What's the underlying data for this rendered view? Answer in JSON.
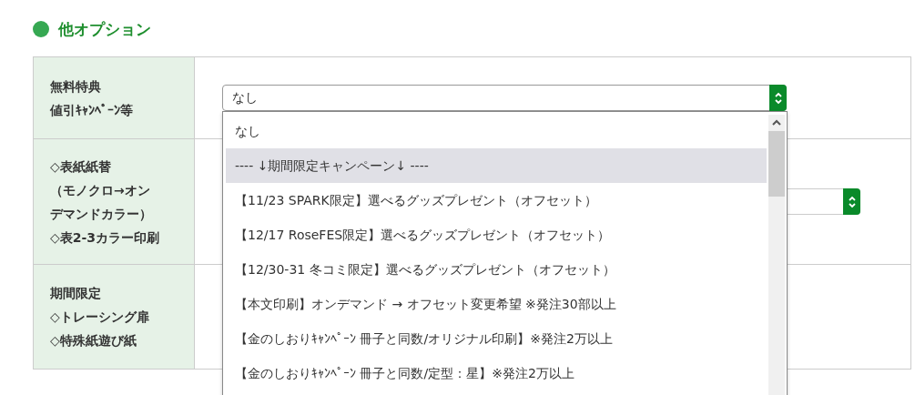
{
  "heading": "他オプション",
  "rows": [
    {
      "label_lines": [
        "無料特典",
        "値引ｷｬﾝﾍﾟｰﾝ等"
      ],
      "select": {
        "value": "なし",
        "open": true
      }
    },
    {
      "label_lines": [
        "◇表紙紙替",
        "（モノクロ→オン",
        "デマンドカラー）",
        "◇表2-3カラー印刷"
      ],
      "select": {
        "open": false
      }
    },
    {
      "label_lines": [
        "期間限定",
        "◇トレーシング扉",
        "◇特殊紙遊び紙"
      ]
    }
  ],
  "dropdown_options": [
    {
      "label": "なし",
      "selected": false
    },
    {
      "label": "---- ↓期間限定キャンペーン↓ ----",
      "selected": true
    },
    {
      "label": "【11/23 SPARK限定】選べるグッズプレゼント（オフセット）",
      "selected": false
    },
    {
      "label": "【12/17 RoseFES限定】選べるグッズプレゼント（オフセット）",
      "selected": false
    },
    {
      "label": "【12/30-31 冬コミ限定】選べるグッズプレゼント（オフセット）",
      "selected": false
    },
    {
      "label": "【本文印刷】オンデマンド → オフセット変更希望 ※発注30部以上",
      "selected": false
    },
    {
      "label": "【金のしおりｷｬﾝﾍﾟｰﾝ 冊子と同数/オリジナル印刷】※発注2万以上",
      "selected": false
    },
    {
      "label": "【金のしおりｷｬﾝﾍﾟｰﾝ 冊子と同数/定型：星】※発注2万以上",
      "selected": false
    }
  ]
}
